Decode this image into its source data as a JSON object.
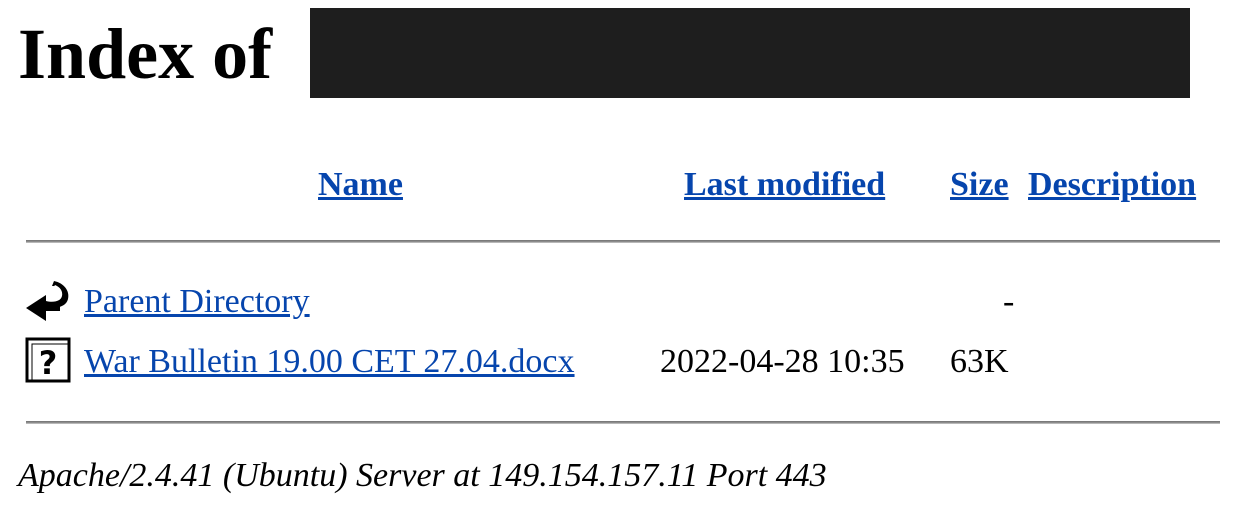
{
  "title": "Index of",
  "columns": {
    "name": "Name",
    "last_modified": "Last modified",
    "size": "Size",
    "description": "Description"
  },
  "rows": [
    {
      "icon": "back-icon",
      "name": "Parent Directory",
      "last_modified": "",
      "size": "-",
      "description": ""
    },
    {
      "icon": "unknown-file-icon",
      "name": "War Bulletin 19.00 CET 27.04.docx",
      "last_modified": "2022-04-28 10:35",
      "size": "63K",
      "description": ""
    }
  ],
  "footer": "Apache/2.4.41 (Ubuntu) Server at 149.154.157.11 Port 443",
  "colors": {
    "link": "#0645ad",
    "redaction": "#1e1e1e",
    "rule": "#8c8c8c"
  }
}
